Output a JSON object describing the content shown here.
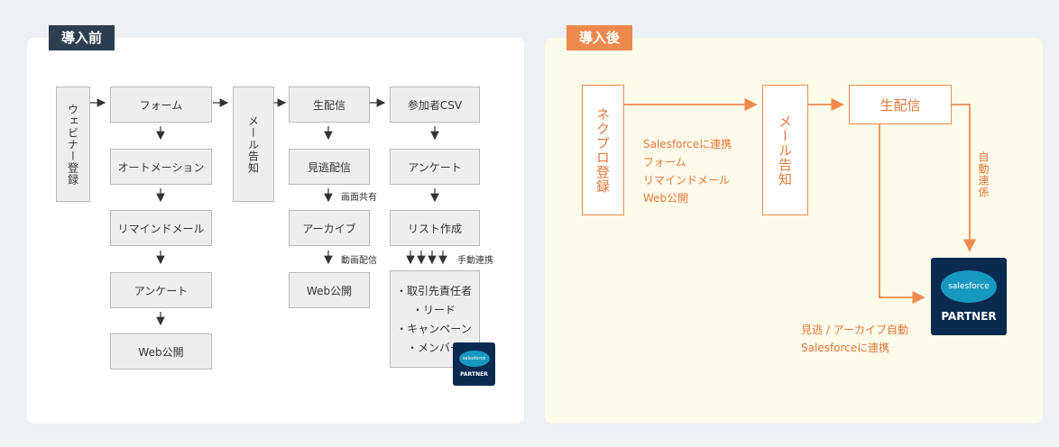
{
  "before": {
    "tag": "導入前",
    "webinar_reg": "ウェビナー登録",
    "form": "フォーム",
    "automation": "オートメーション",
    "remind_mail": "リマインドメール",
    "survey1": "アンケート",
    "web_pub1": "Web公開",
    "mail_notice": "メール告知",
    "live": "生配信",
    "missed": "見逃配信",
    "screen_share": "画面共有",
    "archive": "アーカイブ",
    "video_delivery": "動画配信",
    "web_pub2": "Web公開",
    "csv": "参加者CSV",
    "survey2": "アンケート",
    "list_make": "リスト作成",
    "manual_link": "手動連携",
    "list_items": [
      "・取引先責任者",
      "・リード",
      "・キャンペーン",
      "・メンバー"
    ],
    "sf_logo": "salesforce",
    "sf_partner": "PARTNER"
  },
  "after": {
    "tag": "導入後",
    "nekopuro": "ネクプロ登録",
    "mail_notice": "メール告知",
    "live": "生配信",
    "auto_link": "自動連係",
    "features": [
      "Salesforceに連携",
      "フォーム",
      "リマインドメール",
      "Web公開"
    ],
    "archive_note": [
      "見逃 / アーカイブ自動",
      "Salesforceに連携"
    ],
    "sf_logo": "salesforce",
    "sf_partner": "PARTNER"
  },
  "colors": {
    "dark_tag": "#2c3e50",
    "accent": "#ef8a4f",
    "box_fill": "#eeeeee",
    "sf_navy": "#0b2a4f",
    "sf_cloud": "#1798c1"
  }
}
